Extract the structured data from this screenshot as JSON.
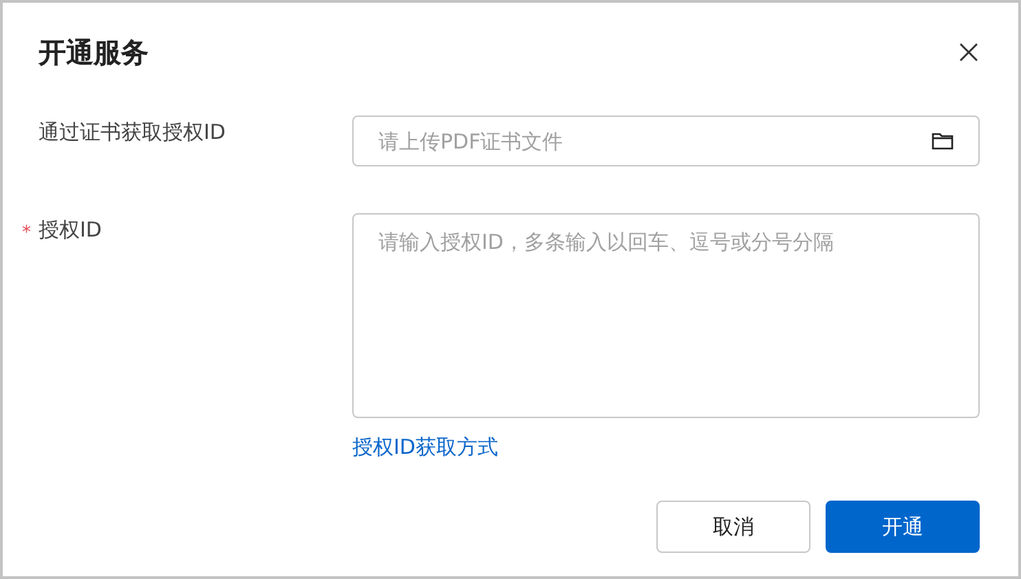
{
  "dialog": {
    "title": "开通服务"
  },
  "fields": [
    {
      "kind": "file",
      "label": "通过证书获取授权ID",
      "placeholder": "请上传PDF证书文件"
    },
    {
      "kind": "textarea",
      "label": "授权ID",
      "required_mark": "*",
      "placeholder": "请输入授权ID，多条输入以回车、逗号或分号分隔",
      "link": "授权ID获取方式"
    }
  ],
  "buttons": [
    {
      "label": "取消",
      "kind": "secondary"
    },
    {
      "label": "开通",
      "kind": "primary"
    }
  ]
}
